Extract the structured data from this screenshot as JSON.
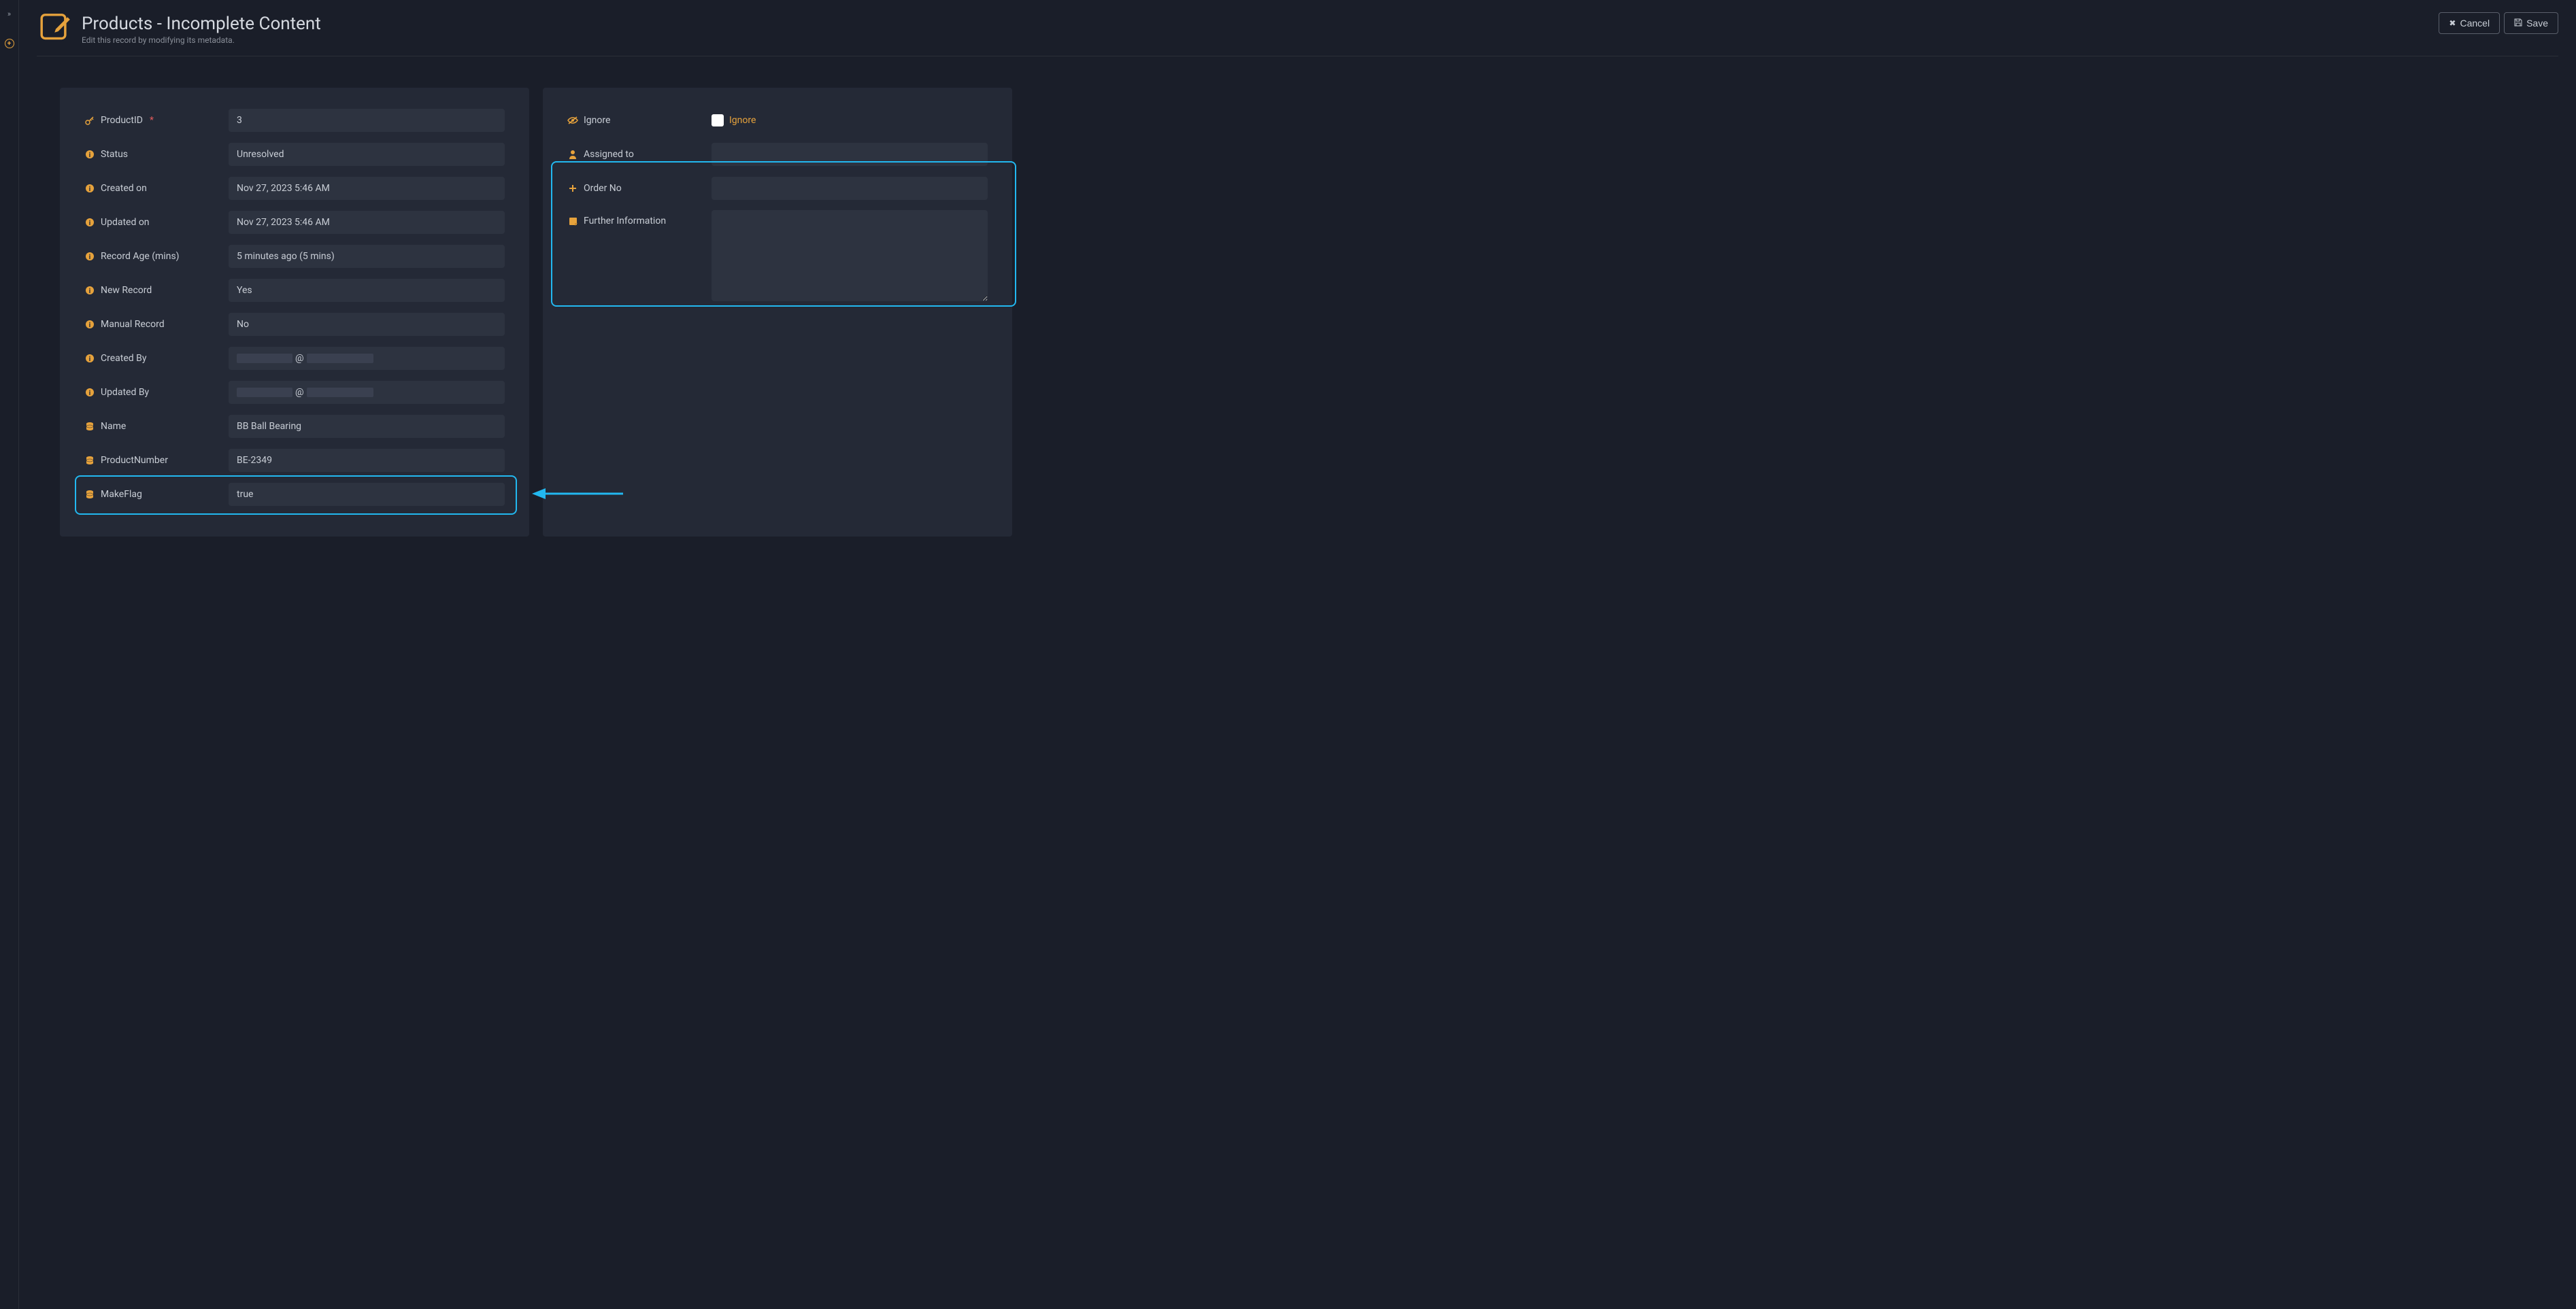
{
  "header": {
    "title": "Products - Incomplete Content",
    "subtitle": "Edit this record by modifying its metadata.",
    "cancel_label": "Cancel",
    "save_label": "Save"
  },
  "left_panel": {
    "product_id": {
      "label": "ProductID",
      "value": "3"
    },
    "status": {
      "label": "Status",
      "value": "Unresolved"
    },
    "created_on": {
      "label": "Created on",
      "value": "Nov 27, 2023 5:46 AM"
    },
    "updated_on": {
      "label": "Updated on",
      "value": "Nov 27, 2023 5:46 AM"
    },
    "record_age": {
      "label": "Record Age (mins)",
      "value": "5 minutes ago (5 mins)"
    },
    "new_record": {
      "label": "New Record",
      "value": "Yes"
    },
    "manual_record": {
      "label": "Manual Record",
      "value": "No"
    },
    "created_by": {
      "label": "Created By",
      "at": "@"
    },
    "updated_by": {
      "label": "Updated By",
      "at": "@"
    },
    "name": {
      "label": "Name",
      "value": "BB Ball Bearing"
    },
    "product_number": {
      "label": "ProductNumber",
      "value": "BE-2349"
    },
    "make_flag": {
      "label": "MakeFlag",
      "value": "true"
    }
  },
  "right_panel": {
    "ignore": {
      "label": "Ignore",
      "checkbox_label": "Ignore"
    },
    "assigned_to": {
      "label": "Assigned to",
      "value": ""
    },
    "order_no": {
      "label": "Order No",
      "value": ""
    },
    "further_info": {
      "label": "Further Information",
      "value": ""
    }
  }
}
